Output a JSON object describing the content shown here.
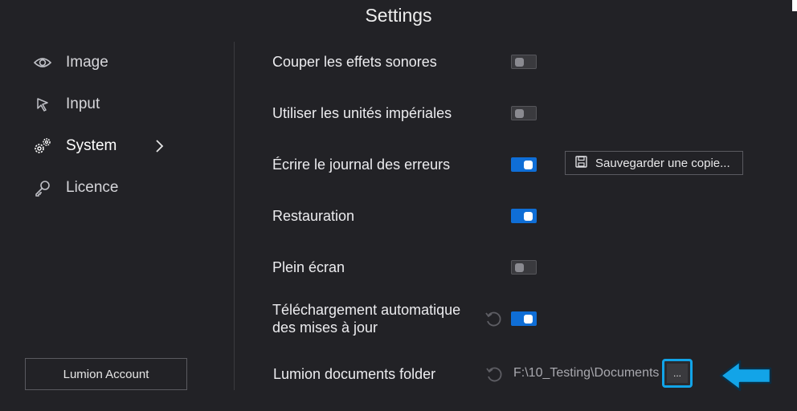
{
  "window": {
    "title": "Settings"
  },
  "sidebar": {
    "items": [
      {
        "label": "Image",
        "icon": "eye-icon"
      },
      {
        "label": "Input",
        "icon": "cursor-icon"
      },
      {
        "label": "System",
        "icon": "gears-icon",
        "active": true
      },
      {
        "label": "Licence",
        "icon": "key-icon"
      }
    ],
    "account_button": "Lumion Account"
  },
  "settings": {
    "rows": [
      {
        "label": "Couper les effets sonores",
        "toggle": "off"
      },
      {
        "label": "Utiliser les unités impériales",
        "toggle": "off"
      },
      {
        "label": "Écrire le journal des erreurs",
        "toggle": "on",
        "button": "Sauvegarder une copie..."
      },
      {
        "label": "Restauration",
        "toggle": "on"
      },
      {
        "label": "Plein écran",
        "toggle": "off"
      },
      {
        "label_line1": "Téléchargement automatique",
        "label_line2": "des mises à jour",
        "toggle": "on"
      }
    ],
    "documents_folder": {
      "label": "Lumion documents folder",
      "path": "F:\\10_Testing\\Documents",
      "browse_label": "..."
    }
  },
  "colors": {
    "background": "#222226",
    "toggle_on": "#0f6ed6",
    "highlight": "#12a4e8"
  }
}
